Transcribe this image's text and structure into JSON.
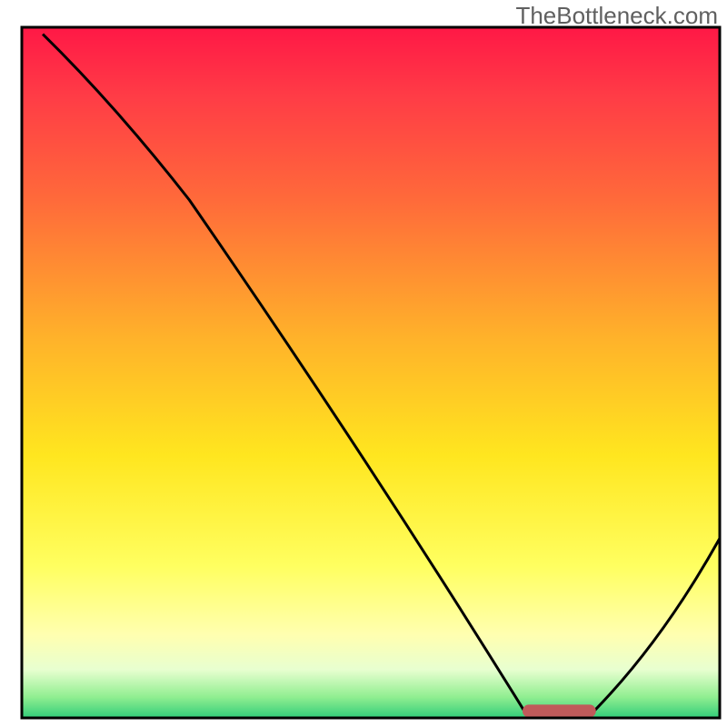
{
  "watermark": "TheBottleneck.com",
  "chart_data": {
    "type": "line",
    "title": "",
    "xlabel": "",
    "ylabel": "",
    "xlim": [
      0,
      100
    ],
    "ylim": [
      0,
      100
    ],
    "grid": false,
    "series": [
      {
        "name": "bottleneck-curve",
        "x": [
          3,
          24,
          72,
          82,
          100
        ],
        "y": [
          99,
          75,
          1,
          1,
          26
        ],
        "notes": "V-shaped curve with steep descent from top-left; inflection near x≈24; minimum plateau roughly x∈[72,82] at y≈1; rises to y≈26 at right edge."
      }
    ],
    "annotations": [
      {
        "name": "min-marker",
        "type": "bar",
        "x_start": 72,
        "x_end": 82,
        "y": 1,
        "color": "#c05a5a",
        "notes": "Rounded red-brown lozenge on the x-axis region where the curve touches the minimum."
      }
    ],
    "background": {
      "type": "vertical-gradient",
      "stops": [
        {
          "pos": 0.0,
          "color": "#ff1846"
        },
        {
          "pos": 0.1,
          "color": "#ff3c46"
        },
        {
          "pos": 0.25,
          "color": "#ff6a3a"
        },
        {
          "pos": 0.45,
          "color": "#ffb22a"
        },
        {
          "pos": 0.62,
          "color": "#ffe61f"
        },
        {
          "pos": 0.78,
          "color": "#ffff60"
        },
        {
          "pos": 0.88,
          "color": "#ffffb0"
        },
        {
          "pos": 0.93,
          "color": "#e8ffd0"
        },
        {
          "pos": 0.97,
          "color": "#90ee90"
        },
        {
          "pos": 1.0,
          "color": "#32cd7a"
        }
      ]
    },
    "frame": {
      "color": "#000000",
      "width": 3
    },
    "curve_style": {
      "color": "#000000",
      "width": 3
    }
  }
}
